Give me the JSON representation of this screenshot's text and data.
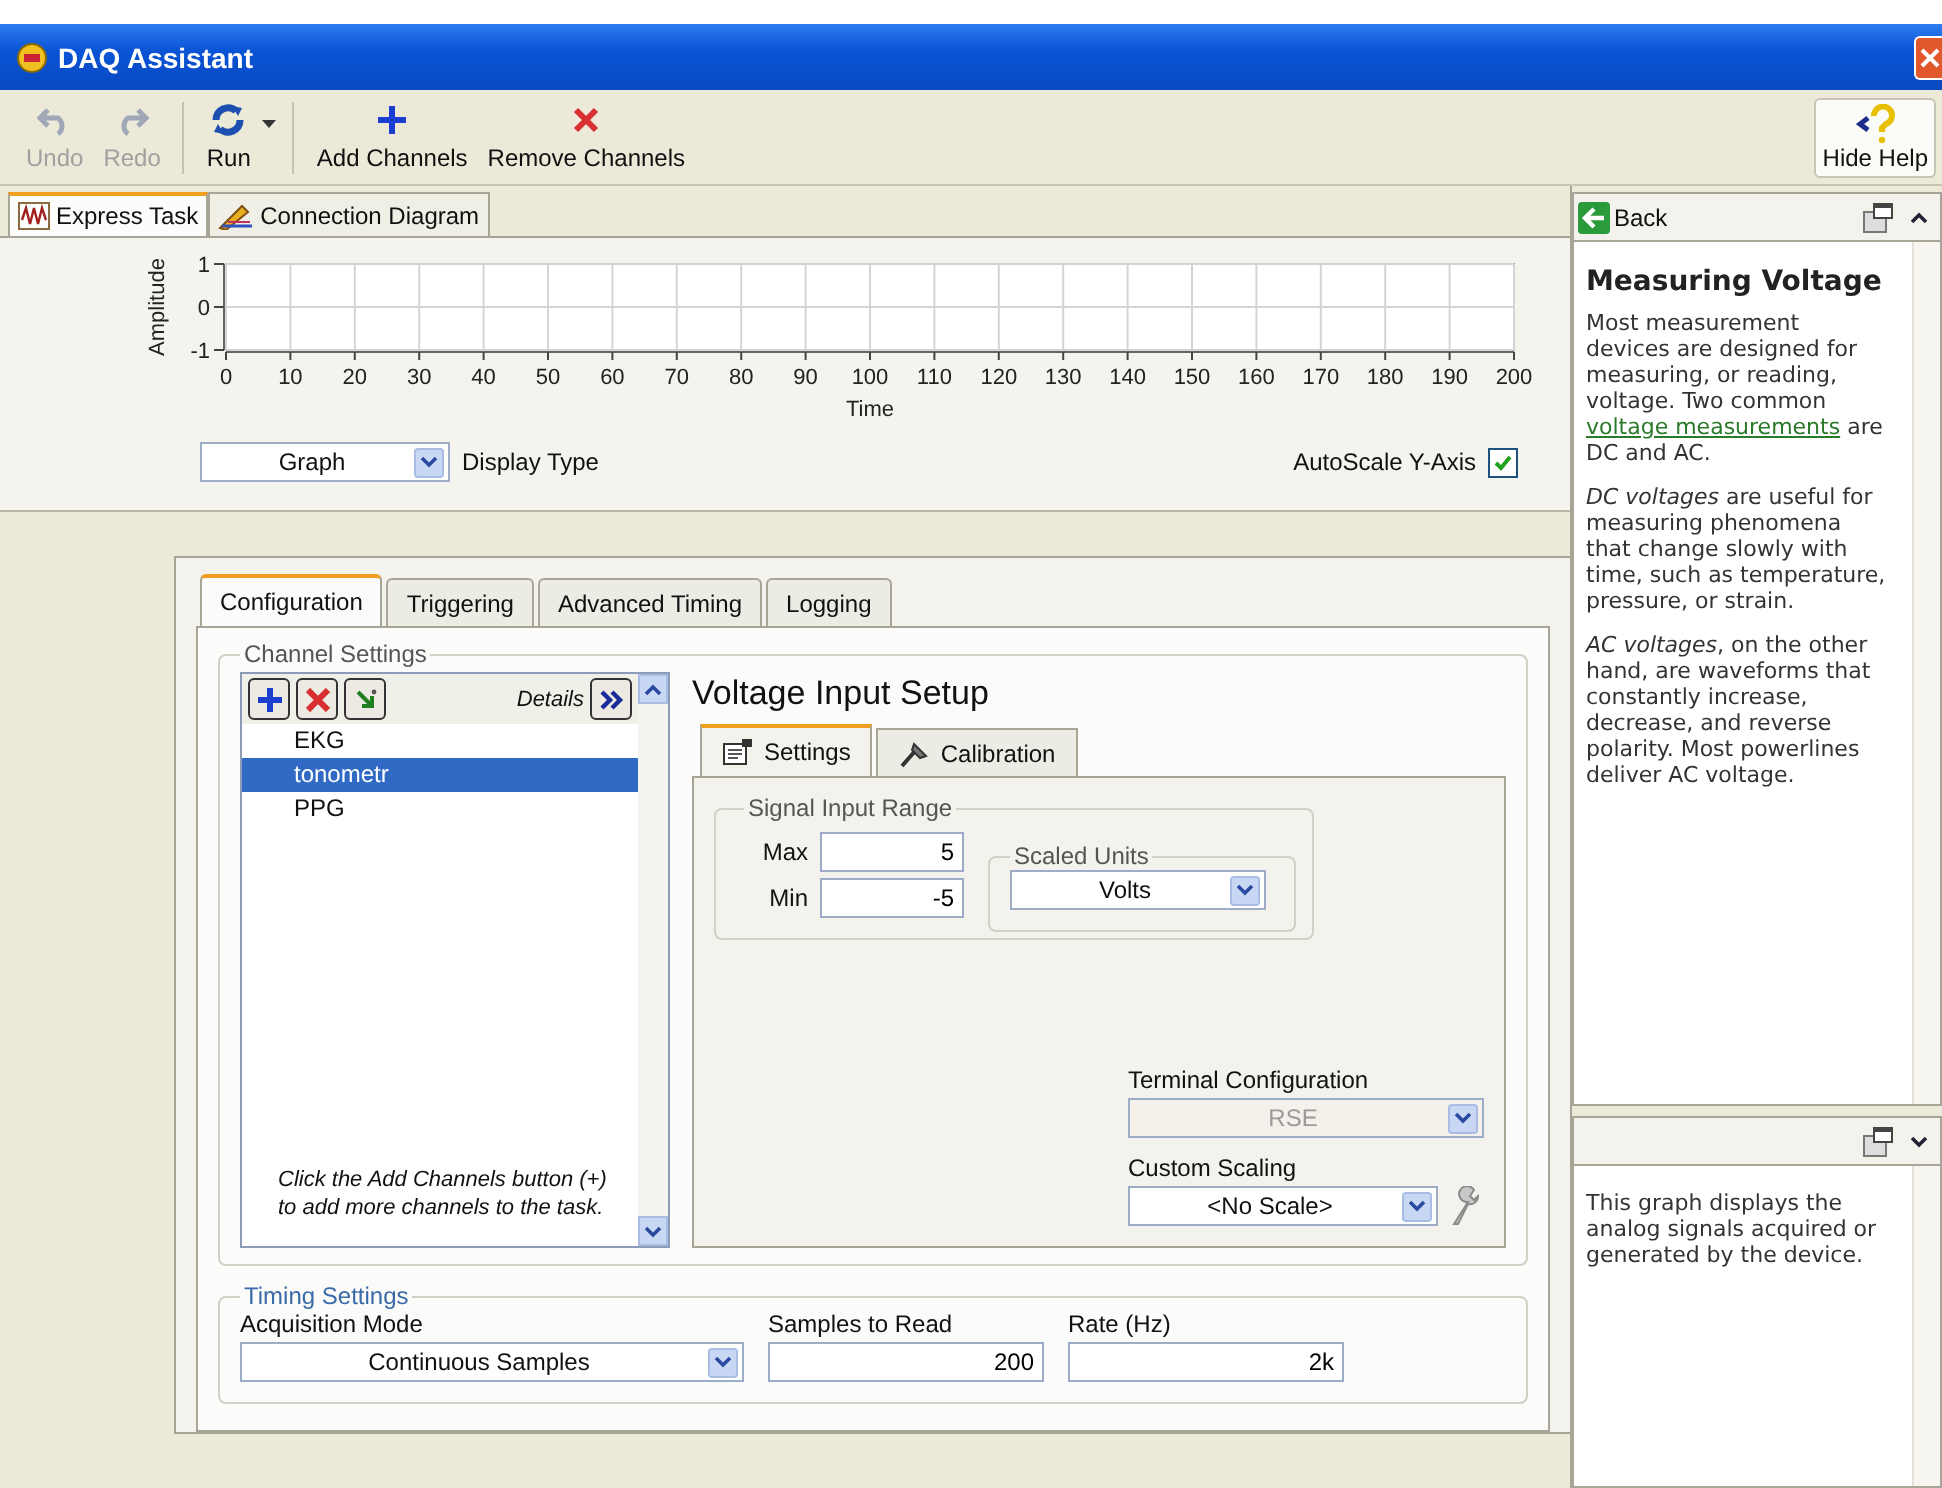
{
  "window": {
    "title": "DAQ Assistant"
  },
  "toolbar": [
    {
      "label": "Undo",
      "kind": "undo",
      "disabled": true
    },
    {
      "label": "Redo",
      "kind": "redo",
      "disabled": true
    },
    {
      "label": "Run",
      "kind": "run",
      "disabled": false
    },
    {
      "label": "Add Channels",
      "kind": "add",
      "disabled": false
    },
    {
      "label": "Remove Channels",
      "kind": "remove",
      "disabled": false
    }
  ],
  "help_button": {
    "label": "Hide Help"
  },
  "view_tabs": [
    {
      "label": "Express Task",
      "kind": "graph",
      "selected": true
    },
    {
      "label": "Connection Diagram",
      "kind": "diagram",
      "selected": false
    }
  ],
  "graph": {
    "chart_data": {
      "type": "line",
      "grid": true,
      "xlabel": "Time",
      "ylabel": "Amplitude",
      "xlim": [
        0,
        200
      ],
      "ylim": [
        -1,
        1
      ],
      "xticks": [
        0,
        10,
        20,
        30,
        40,
        50,
        60,
        70,
        80,
        90,
        100,
        110,
        120,
        130,
        140,
        150,
        160,
        170,
        180,
        190,
        200
      ],
      "yticks": [
        -1,
        0,
        1
      ]
    },
    "display_type": {
      "value": "Graph",
      "label": "Display Type"
    },
    "autoscale": {
      "label": "AutoScale Y-Axis",
      "checked": true
    }
  },
  "config_tabs": [
    {
      "label": "Configuration",
      "selected": true
    },
    {
      "label": "Triggering",
      "selected": false
    },
    {
      "label": "Advanced Timing",
      "selected": false
    },
    {
      "label": "Logging",
      "selected": false
    }
  ],
  "channel_settings": {
    "title": "Channel Settings",
    "details_label": "Details",
    "channels": [
      {
        "name": "EKG",
        "selected": false
      },
      {
        "name": "tonometr",
        "selected": true
      },
      {
        "name": "PPG",
        "selected": false
      }
    ],
    "hint": "Click the Add Channels button (+) to add more channels to the task."
  },
  "voltage_setup": {
    "title": "Voltage Input Setup",
    "tabs": [
      {
        "label": "Settings",
        "kind": "settings",
        "selected": true
      },
      {
        "label": "Calibration",
        "kind": "calibration",
        "selected": false
      }
    ],
    "signal_range": {
      "title": "Signal Input Range",
      "max_label": "Max",
      "max": "5",
      "min_label": "Min",
      "min": "-5"
    },
    "scaled_units": {
      "title": "Scaled Units",
      "value": "Volts"
    },
    "terminal": {
      "label": "Terminal Configuration",
      "value": "RSE",
      "disabled": true
    },
    "custom_scaling": {
      "label": "Custom Scaling",
      "value": "<No Scale>"
    }
  },
  "timing": {
    "title": "Timing Settings",
    "fields": [
      {
        "label": "Acquisition Mode",
        "value": "Continuous Samples",
        "kind": "dropdown"
      },
      {
        "label": "Samples to Read",
        "value": "200",
        "kind": "number"
      },
      {
        "label": "Rate (Hz)",
        "value": "2k",
        "kind": "number"
      }
    ]
  },
  "help": {
    "back_label": "Back",
    "title": "Measuring Voltage",
    "paragraphs": [
      {
        "before": "Most measurement devices are designed for measuring, or reading, voltage. Two common ",
        "link": "voltage measurements",
        "after": " are DC and AC."
      },
      {
        "text": "*DC voltages* are useful for measuring phenomena that change slowly with time, such as temperature, pressure, or strain."
      },
      {
        "text": "*AC voltages*, on the other hand, are waveforms that constantly increase, decrease, and reverse polarity. Most powerlines deliver AC voltage."
      }
    ],
    "graph_help": "This graph displays the analog signals acquired or generated by the device."
  }
}
